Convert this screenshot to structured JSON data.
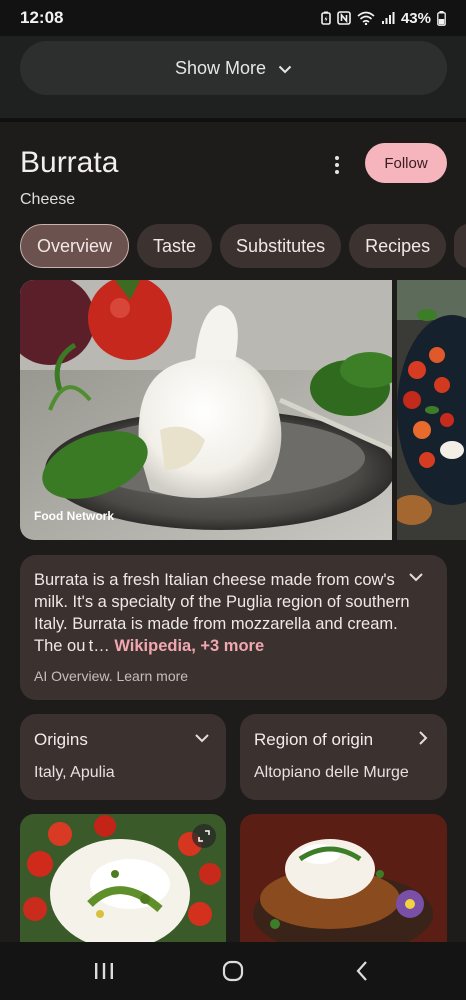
{
  "status_bar": {
    "time": "12:08",
    "battery": "43%",
    "icons": [
      "battery-saver-icon",
      "nfc-icon",
      "wifi-icon",
      "signal-icon",
      "battery-icon"
    ]
  },
  "top": {
    "show_more_label": "Show More"
  },
  "entity": {
    "title": "Burrata",
    "subtitle": "Cheese",
    "follow_label": "Follow"
  },
  "tabs": [
    {
      "label": "Overview",
      "active": true
    },
    {
      "label": "Taste",
      "active": false
    },
    {
      "label": "Substitutes",
      "active": false
    },
    {
      "label": "Recipes",
      "active": false
    }
  ],
  "images": {
    "hero_caption": "Food Network"
  },
  "overview": {
    "text": "Burrata is a fresh Italian cheese made from cow's milk. It's a specialty of the Puglia region of southern Italy. Burrata is made from mozzarella and cream. The ou t…",
    "link": "Wikipedia, +3 more",
    "footer": "AI Overview. Learn more"
  },
  "facts": [
    {
      "label": "Origins",
      "value": "Italy, Apulia",
      "icon": "chevron-down-icon"
    },
    {
      "label": "Region of origin",
      "value": "Altopiano delle Murge",
      "icon": "chevron-right-icon"
    }
  ],
  "colors": {
    "accent": "#f6b4bd",
    "link": "#f2a7b0",
    "card": "#3b3230",
    "chip": "#3c3331",
    "chip_active": "#6c524f"
  }
}
